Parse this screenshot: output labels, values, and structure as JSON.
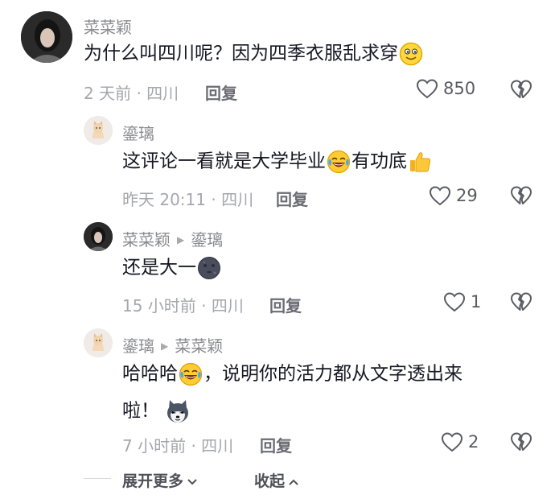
{
  "comments": [
    {
      "user": "菜菜颖",
      "text_before": "为什么叫四川呢？因为四季衣服乱求穿",
      "time": "2 天前 · 四川",
      "reply_label": "回复",
      "likes": "850"
    },
    {
      "user": "鎏璃",
      "text_part1": "这评论一看就是大学毕业",
      "text_part2": "有功底",
      "time": "昨天 20:11 · 四川",
      "reply_label": "回复",
      "likes": "29"
    },
    {
      "user": "菜菜颖",
      "reply_to": "鎏璃",
      "text_before": "还是大一",
      "time": "15 小时前 · 四川",
      "reply_label": "回复",
      "likes": "1"
    },
    {
      "user": "鎏璃",
      "reply_to": "菜菜颖",
      "text_part1": "哈哈哈",
      "text_part2": "，说明你的活力都从文字透出来",
      "text_line2": "啦！",
      "time": "7 小时前 · 四川",
      "reply_label": "回复",
      "likes": "2"
    }
  ],
  "footer": {
    "expand_label": "展开更多",
    "collapse_label": "收起"
  },
  "icons": {
    "like": "heart-outline-icon",
    "dislike": "broken-heart-icon",
    "reply_arrow": "triangle-right-icon"
  },
  "colors": {
    "text": "#161823",
    "username": "#8a8b91",
    "meta": "#a5a7ad",
    "reply": "#6b6d74",
    "icon": "#5a5c63"
  }
}
